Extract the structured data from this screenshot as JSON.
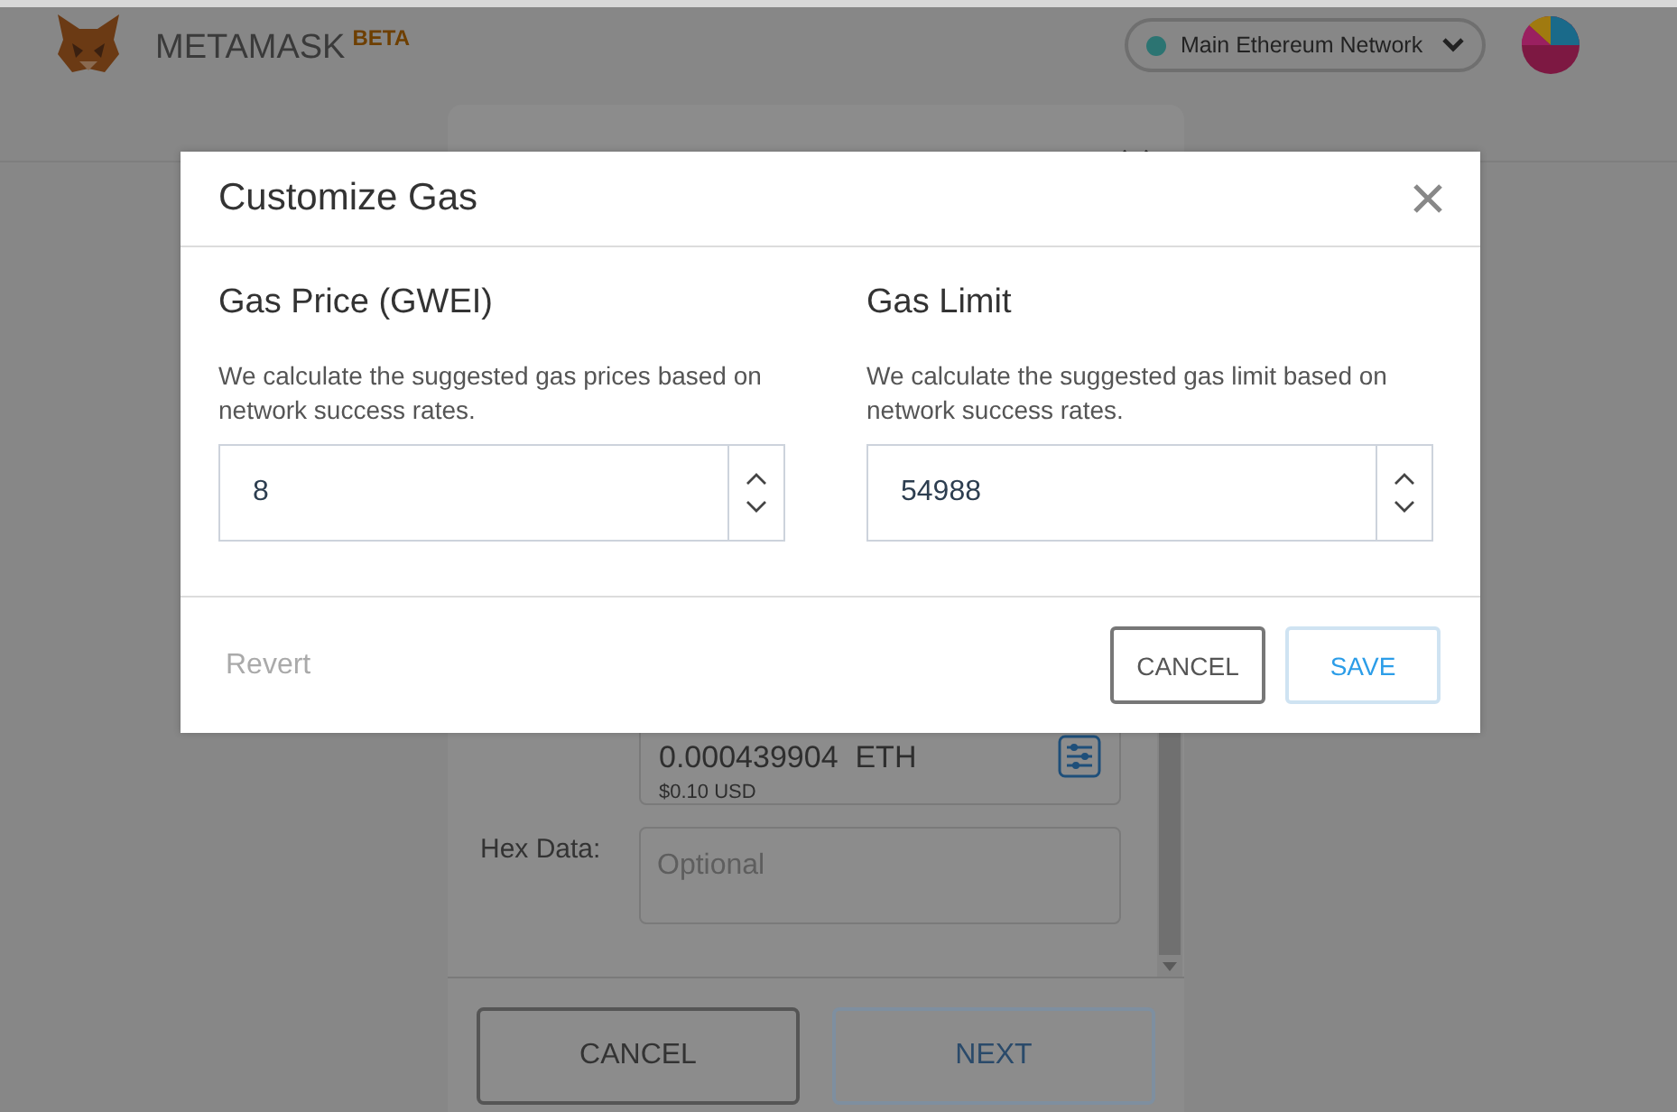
{
  "header": {
    "brand": "METAMASK",
    "badge": "BETA",
    "network": "Main Ethereum Network"
  },
  "send_card": {
    "gas_amount": "0.000439904  ETH",
    "gas_usd": "$0.10 USD",
    "hex_label": "Hex Data:",
    "hex_placeholder": "Optional",
    "buttons": [
      {
        "label": "CANCEL",
        "kind": "secondary"
      },
      {
        "label": "NEXT",
        "kind": "primary"
      }
    ]
  },
  "modal": {
    "title": "Customize Gas",
    "fields": [
      {
        "title": "Gas Price (GWEI)",
        "description": "We calculate the suggested gas prices based on network success rates.",
        "value": "8"
      },
      {
        "title": "Gas Limit",
        "description": "We calculate the suggested gas limit based on network success rates.",
        "value": "54988"
      }
    ],
    "revert": "Revert",
    "buttons": [
      {
        "label": "CANCEL",
        "kind": "secondary"
      },
      {
        "label": "SAVE",
        "kind": "primary"
      }
    ]
  }
}
